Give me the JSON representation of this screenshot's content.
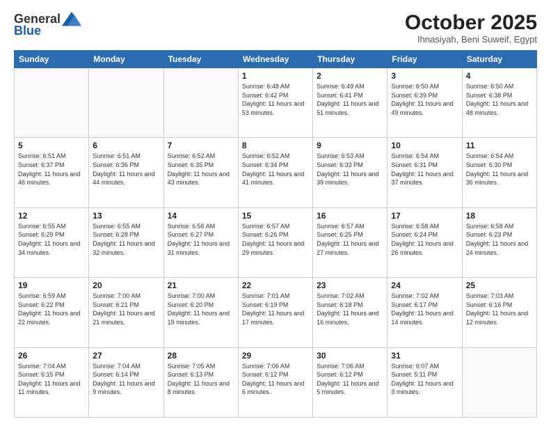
{
  "header": {
    "logo_general": "General",
    "logo_blue": "Blue",
    "month_title": "October 2025",
    "location": "Ihnasiyah, Beni Suweif, Egypt"
  },
  "days_of_week": [
    "Sunday",
    "Monday",
    "Tuesday",
    "Wednesday",
    "Thursday",
    "Friday",
    "Saturday"
  ],
  "weeks": [
    [
      {
        "day": "",
        "info": ""
      },
      {
        "day": "",
        "info": ""
      },
      {
        "day": "",
        "info": ""
      },
      {
        "day": "1",
        "info": "Sunrise: 6:48 AM\nSunset: 6:42 PM\nDaylight: 11 hours\nand 53 minutes."
      },
      {
        "day": "2",
        "info": "Sunrise: 6:49 AM\nSunset: 6:41 PM\nDaylight: 11 hours\nand 51 minutes."
      },
      {
        "day": "3",
        "info": "Sunrise: 6:50 AM\nSunset: 6:39 PM\nDaylight: 11 hours\nand 49 minutes."
      },
      {
        "day": "4",
        "info": "Sunrise: 6:50 AM\nSunset: 6:38 PM\nDaylight: 11 hours\nand 48 minutes."
      }
    ],
    [
      {
        "day": "5",
        "info": "Sunrise: 6:51 AM\nSunset: 6:37 PM\nDaylight: 11 hours\nand 46 minutes."
      },
      {
        "day": "6",
        "info": "Sunrise: 6:51 AM\nSunset: 6:36 PM\nDaylight: 11 hours\nand 44 minutes."
      },
      {
        "day": "7",
        "info": "Sunrise: 6:52 AM\nSunset: 6:35 PM\nDaylight: 11 hours\nand 43 minutes."
      },
      {
        "day": "8",
        "info": "Sunrise: 6:52 AM\nSunset: 6:34 PM\nDaylight: 11 hours\nand 41 minutes."
      },
      {
        "day": "9",
        "info": "Sunrise: 6:53 AM\nSunset: 6:33 PM\nDaylight: 11 hours\nand 39 minutes."
      },
      {
        "day": "10",
        "info": "Sunrise: 6:54 AM\nSunset: 6:31 PM\nDaylight: 11 hours\nand 37 minutes."
      },
      {
        "day": "11",
        "info": "Sunrise: 6:54 AM\nSunset: 6:30 PM\nDaylight: 11 hours\nand 36 minutes."
      }
    ],
    [
      {
        "day": "12",
        "info": "Sunrise: 6:55 AM\nSunset: 6:29 PM\nDaylight: 11 hours\nand 34 minutes."
      },
      {
        "day": "13",
        "info": "Sunrise: 6:55 AM\nSunset: 6:28 PM\nDaylight: 11 hours\nand 32 minutes."
      },
      {
        "day": "14",
        "info": "Sunrise: 6:56 AM\nSunset: 6:27 PM\nDaylight: 11 hours\nand 31 minutes."
      },
      {
        "day": "15",
        "info": "Sunrise: 6:57 AM\nSunset: 6:26 PM\nDaylight: 11 hours\nand 29 minutes."
      },
      {
        "day": "16",
        "info": "Sunrise: 6:57 AM\nSunset: 6:25 PM\nDaylight: 11 hours\nand 27 minutes."
      },
      {
        "day": "17",
        "info": "Sunrise: 6:58 AM\nSunset: 6:24 PM\nDaylight: 11 hours\nand 26 minutes."
      },
      {
        "day": "18",
        "info": "Sunrise: 6:58 AM\nSunset: 6:23 PM\nDaylight: 11 hours\nand 24 minutes."
      }
    ],
    [
      {
        "day": "19",
        "info": "Sunrise: 6:59 AM\nSunset: 6:22 PM\nDaylight: 11 hours\nand 22 minutes."
      },
      {
        "day": "20",
        "info": "Sunrise: 7:00 AM\nSunset: 6:21 PM\nDaylight: 11 hours\nand 21 minutes."
      },
      {
        "day": "21",
        "info": "Sunrise: 7:00 AM\nSunset: 6:20 PM\nDaylight: 11 hours\nand 19 minutes."
      },
      {
        "day": "22",
        "info": "Sunrise: 7:01 AM\nSunset: 6:19 PM\nDaylight: 11 hours\nand 17 minutes."
      },
      {
        "day": "23",
        "info": "Sunrise: 7:02 AM\nSunset: 6:18 PM\nDaylight: 11 hours\nand 16 minutes."
      },
      {
        "day": "24",
        "info": "Sunrise: 7:02 AM\nSunset: 6:17 PM\nDaylight: 11 hours\nand 14 minutes."
      },
      {
        "day": "25",
        "info": "Sunrise: 7:03 AM\nSunset: 6:16 PM\nDaylight: 11 hours\nand 12 minutes."
      }
    ],
    [
      {
        "day": "26",
        "info": "Sunrise: 7:04 AM\nSunset: 6:15 PM\nDaylight: 11 hours\nand 11 minutes."
      },
      {
        "day": "27",
        "info": "Sunrise: 7:04 AM\nSunset: 6:14 PM\nDaylight: 11 hours\nand 9 minutes."
      },
      {
        "day": "28",
        "info": "Sunrise: 7:05 AM\nSunset: 6:13 PM\nDaylight: 11 hours\nand 8 minutes."
      },
      {
        "day": "29",
        "info": "Sunrise: 7:06 AM\nSunset: 6:12 PM\nDaylight: 11 hours\nand 6 minutes."
      },
      {
        "day": "30",
        "info": "Sunrise: 7:06 AM\nSunset: 6:12 PM\nDaylight: 11 hours\nand 5 minutes."
      },
      {
        "day": "31",
        "info": "Sunrise: 6:07 AM\nSunset: 5:11 PM\nDaylight: 11 hours\nand 3 minutes."
      },
      {
        "day": "",
        "info": ""
      }
    ]
  ]
}
